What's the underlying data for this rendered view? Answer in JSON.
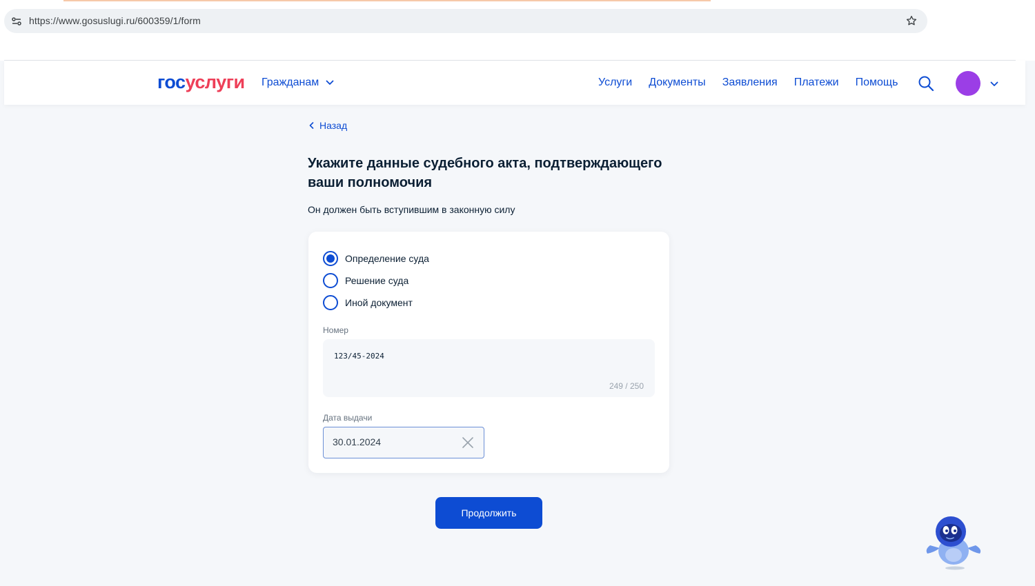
{
  "browser": {
    "url": "https://www.gosuslugi.ru/600359/1/form"
  },
  "header": {
    "logo_gos": "гос",
    "logo_uslugi": "услуги",
    "citizens_menu": "Гражданам",
    "nav": [
      "Услуги",
      "Документы",
      "Заявления",
      "Платежи",
      "Помощь"
    ],
    "avatar_color": "#9b3ee6"
  },
  "main": {
    "back_label": "Назад",
    "title": "Укажите данные судебного акта, подтверждающего ваши полномочия",
    "subtitle": "Он должен быть вступившим в законную силу",
    "radio_options": [
      {
        "label": "Определение суда",
        "checked": true
      },
      {
        "label": "Решение суда",
        "checked": false
      },
      {
        "label": "Иной документ",
        "checked": false
      }
    ],
    "number_field": {
      "label": "Номер",
      "value": "123/45-2024",
      "counter": "249 / 250"
    },
    "date_field": {
      "label": "Дата выдачи",
      "value": "30.01.2024"
    },
    "continue_label": "Продолжить"
  },
  "colors": {
    "primary": "#0d4cd3",
    "logo_red": "#ee3f58",
    "background": "#f5f7fa"
  }
}
